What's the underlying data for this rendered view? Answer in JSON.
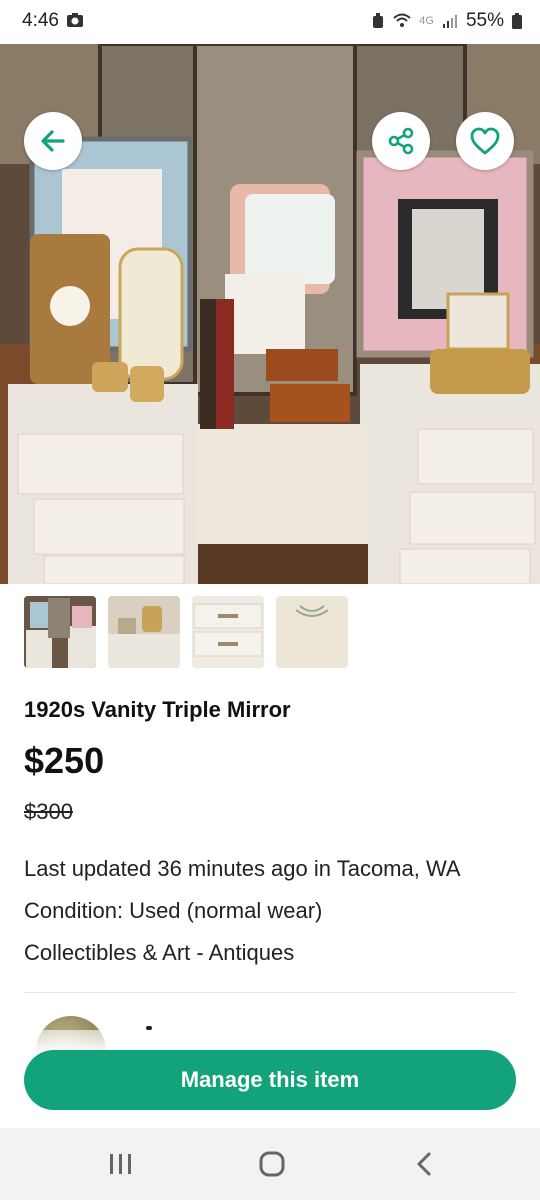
{
  "status_bar": {
    "time": "4:46",
    "network": "4G",
    "battery": "55%"
  },
  "hero": {
    "icons": {
      "back": "arrow-left-icon",
      "share": "share-icon",
      "favorite": "heart-outline-icon"
    },
    "accent_color": "#13a37a"
  },
  "thumbnails": [
    {
      "name": "thumb-1"
    },
    {
      "name": "thumb-2"
    },
    {
      "name": "thumb-3"
    },
    {
      "name": "thumb-4"
    }
  ],
  "listing": {
    "title": "1920s Vanity Triple Mirror",
    "price": "$250",
    "original_price": "$300",
    "updated": "Last updated 36 minutes ago in Tacoma, WA",
    "condition": "Condition: Used (normal wear)",
    "category": "Collectibles & Art - Antiques"
  },
  "actions": {
    "manage_label": "Manage this item",
    "button_color": "#13a37a"
  }
}
